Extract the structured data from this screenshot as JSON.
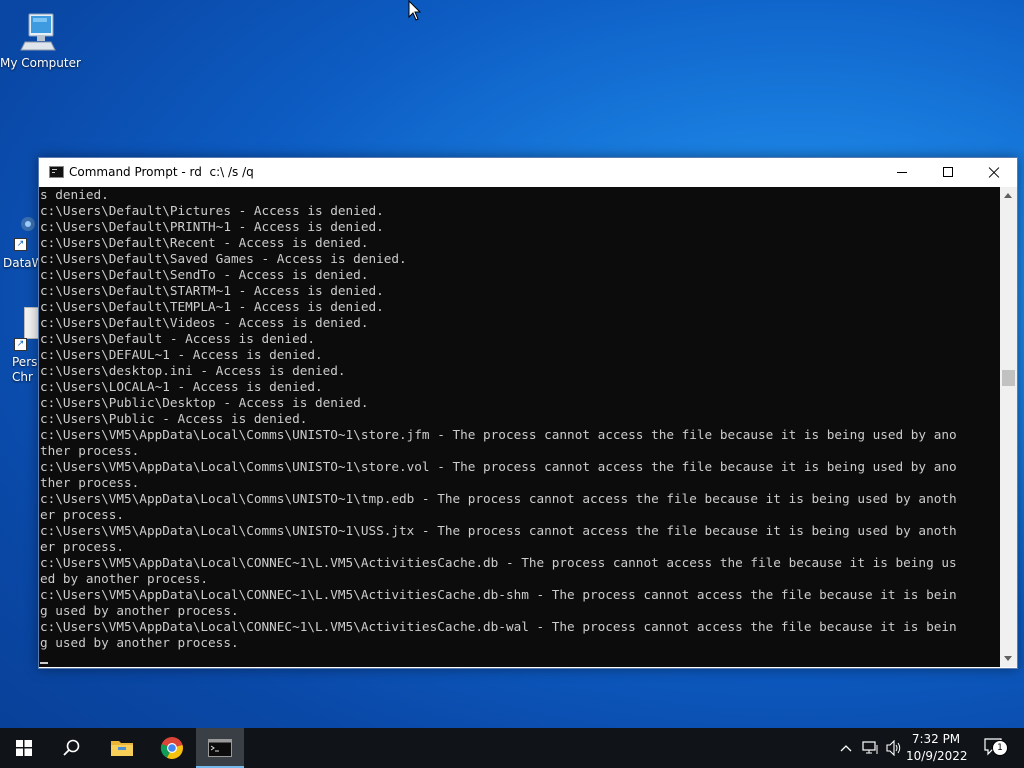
{
  "desktop": {
    "icons": [
      {
        "label": "My Computer"
      },
      {
        "label": "DataW"
      },
      {
        "label": "Perso Chr"
      }
    ]
  },
  "window": {
    "title": "Command Prompt - rd  c:\\ /s /q",
    "console_lines": [
      "s denied.",
      "c:\\Users\\Default\\Pictures - Access is denied.",
      "c:\\Users\\Default\\PRINTH~1 - Access is denied.",
      "c:\\Users\\Default\\Recent - Access is denied.",
      "c:\\Users\\Default\\Saved Games - Access is denied.",
      "c:\\Users\\Default\\SendTo - Access is denied.",
      "c:\\Users\\Default\\STARTM~1 - Access is denied.",
      "c:\\Users\\Default\\TEMPLA~1 - Access is denied.",
      "c:\\Users\\Default\\Videos - Access is denied.",
      "c:\\Users\\Default - Access is denied.",
      "c:\\Users\\DEFAUL~1 - Access is denied.",
      "c:\\Users\\desktop.ini - Access is denied.",
      "c:\\Users\\LOCALA~1 - Access is denied.",
      "c:\\Users\\Public\\Desktop - Access is denied.",
      "c:\\Users\\Public - Access is denied.",
      "c:\\Users\\VM5\\AppData\\Local\\Comms\\UNISTO~1\\store.jfm - The process cannot access the file because it is being used by ano",
      "ther process.",
      "c:\\Users\\VM5\\AppData\\Local\\Comms\\UNISTO~1\\store.vol - The process cannot access the file because it is being used by ano",
      "ther process.",
      "c:\\Users\\VM5\\AppData\\Local\\Comms\\UNISTO~1\\tmp.edb - The process cannot access the file because it is being used by anoth",
      "er process.",
      "c:\\Users\\VM5\\AppData\\Local\\Comms\\UNISTO~1\\USS.jtx - The process cannot access the file because it is being used by anoth",
      "er process.",
      "c:\\Users\\VM5\\AppData\\Local\\CONNEC~1\\L.VM5\\ActivitiesCache.db - The process cannot access the file because it is being us",
      "ed by another process.",
      "c:\\Users\\VM5\\AppData\\Local\\CONNEC~1\\L.VM5\\ActivitiesCache.db-shm - The process cannot access the file because it is bein",
      "g used by another process.",
      "c:\\Users\\VM5\\AppData\\Local\\CONNEC~1\\L.VM5\\ActivitiesCache.db-wal - The process cannot access the file because it is bein",
      "g used by another process."
    ]
  },
  "taskbar": {
    "clock_time": "7:32 PM",
    "clock_date": "10/9/2022",
    "notification_count": "1",
    "accent_color": "#76b9ed"
  }
}
